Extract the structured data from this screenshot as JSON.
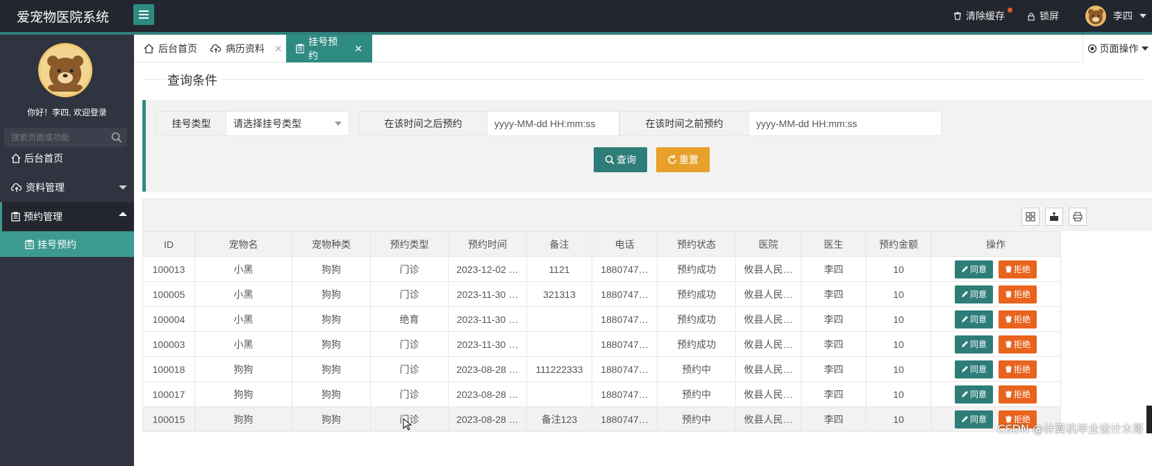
{
  "app": {
    "title": "爱宠物医院系统"
  },
  "header": {
    "clear_cache": "清除缓存",
    "lock_screen": "锁屏",
    "user_name": "李四"
  },
  "sidebar": {
    "welcome": "你好！李四, 欢迎登录",
    "search_placeholder": "搜索页面或功能",
    "items": [
      {
        "label": "后台首页",
        "icon": "home-icon"
      },
      {
        "label": "资料管理",
        "icon": "cloud-icon"
      },
      {
        "label": "预约管理",
        "icon": "clipboard-icon"
      }
    ],
    "sub_items": [
      {
        "label": "挂号预约",
        "icon": "clipboard-icon"
      }
    ]
  },
  "tabs": [
    {
      "label": "后台首页",
      "icon": "home-icon"
    },
    {
      "label": "病历资料",
      "icon": "cloud-icon"
    },
    {
      "label": "挂号预约",
      "icon": "clipboard-icon",
      "active": true
    }
  ],
  "page_op": "页面操作",
  "query": {
    "section_title": "查询条件",
    "type_label": "挂号类型",
    "type_placeholder": "请选择挂号类型",
    "after_label": "在该时间之后预约",
    "after_placeholder": "yyyy-MM-dd HH:mm:ss",
    "before_label": "在该时间之前预约",
    "before_placeholder": "yyyy-MM-dd HH:mm:ss",
    "search_btn": "查询",
    "reset_btn": "重置"
  },
  "table": {
    "columns": [
      "ID",
      "宠物名",
      "宠物种类",
      "预约类型",
      "预约时间",
      "备注",
      "电话",
      "预约状态",
      "医院",
      "医生",
      "预约金额",
      "操作"
    ],
    "approve_label": "同意",
    "reject_label": "拒绝",
    "rows": [
      [
        "100013",
        "小黑",
        "狗狗",
        "门诊",
        "2023-12-02 …",
        "1121",
        "1880747…",
        "预约成功",
        "攸县人民…",
        "李四",
        "10"
      ],
      [
        "100005",
        "小黑",
        "狗狗",
        "门诊",
        "2023-11-30 …",
        "321313",
        "1880747…",
        "预约成功",
        "攸县人民…",
        "李四",
        "10"
      ],
      [
        "100004",
        "小黑",
        "狗狗",
        "绝育",
        "2023-11-30 …",
        "",
        "1880747…",
        "预约成功",
        "攸县人民…",
        "李四",
        "10"
      ],
      [
        "100003",
        "小黑",
        "狗狗",
        "门诊",
        "2023-11-30 …",
        "",
        "1880747…",
        "预约成功",
        "攸县人民…",
        "李四",
        "10"
      ],
      [
        "100018",
        "狗狗",
        "狗狗",
        "门诊",
        "2023-08-28 …",
        "111222333",
        "1880747…",
        "预约中",
        "攸县人民…",
        "李四",
        "10"
      ],
      [
        "100017",
        "狗狗",
        "狗狗",
        "门诊",
        "2023-08-28 …",
        "",
        "1880747…",
        "预约中",
        "攸县人民…",
        "李四",
        "10"
      ],
      [
        "100015",
        "狗狗",
        "狗狗",
        "门诊",
        "2023-08-28 …",
        "备注123",
        "1880747…",
        "预约中",
        "攸县人民…",
        "李四",
        "10"
      ]
    ]
  },
  "watermark": "CSDN @计算机毕业设计木哥",
  "colors": {
    "topbar": "#23262e",
    "sidebar": "#2f3440",
    "accent": "#2e8b82",
    "warning": "#e8a02a",
    "danger": "#e8631e"
  }
}
